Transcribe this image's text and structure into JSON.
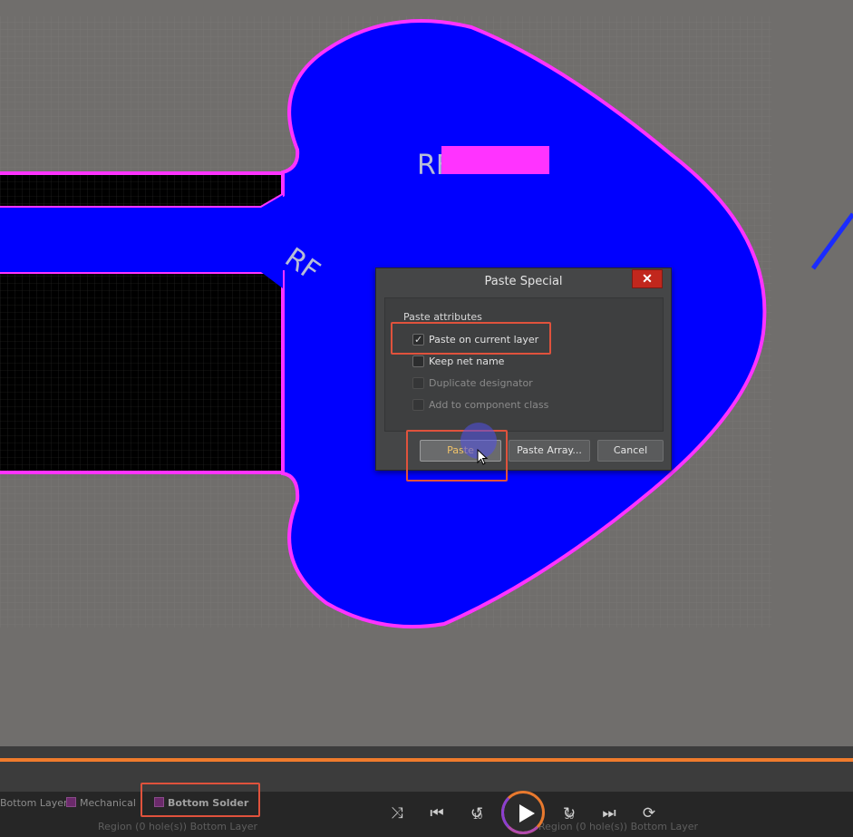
{
  "canvas": {
    "silkscreen_labels": [
      "RF",
      "RF"
    ],
    "colors": {
      "background": "#706e6c",
      "copper_region": "#0000ff",
      "outline": "#ff33ff",
      "cutout": "#000000",
      "silkscreen": "#b6bcd6"
    }
  },
  "dialog": {
    "title": "Paste Special",
    "close_label": "✕",
    "group_label": "Paste attributes",
    "options": [
      {
        "label": "Paste on current layer",
        "checked": true,
        "enabled": true
      },
      {
        "label": "Keep net name",
        "checked": false,
        "enabled": true
      },
      {
        "label": "Duplicate designator",
        "checked": false,
        "enabled": false
      },
      {
        "label": "Add to component class",
        "checked": false,
        "enabled": false
      }
    ],
    "buttons": {
      "paste": "Paste",
      "paste_array": "Paste Array...",
      "cancel": "Cancel"
    }
  },
  "layer_tabs": {
    "bottom_layer": "Bottom Layer",
    "mechanical": "Mechanical",
    "bottom_solder": "Bottom Solder"
  },
  "status": {
    "left": "Region (0 hole(s)) Bottom Layer",
    "right": "Region (0 hole(s)) Bottom Layer"
  },
  "player": {
    "skip_back_seconds": "10",
    "skip_forward_seconds": "30",
    "accent_color": "#f07b2c",
    "highlight_color": "#e0523c"
  }
}
